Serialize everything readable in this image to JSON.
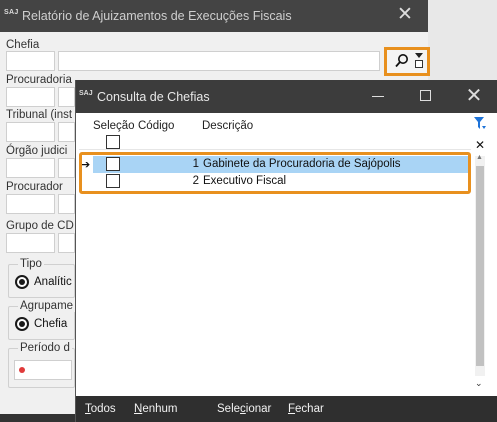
{
  "background_window": {
    "logo": "SAJ",
    "title": "Relatório de Ajuizamentos de Execuções Fiscais",
    "close": "✕",
    "labels": {
      "chefia": "Chefia",
      "procuradoria": "Procuradoria",
      "tribunal": "Tribunal (inst",
      "orgao": "Órgão judici",
      "procurador": "Procurador",
      "grupo": "Grupo de CD"
    },
    "tipo": {
      "legend": "Tipo",
      "option": "Analític"
    },
    "agrupamento": {
      "legend": "Agrupame",
      "option": "Chefia"
    },
    "periodo": {
      "legend": "Período d"
    }
  },
  "dialog": {
    "logo": "SAJ",
    "title": "Consulta de Chefias",
    "columns": {
      "selection": "Seleção",
      "code": "Código",
      "description": "Descrição"
    },
    "rows": [
      {
        "code": "1",
        "description": "Gabinete da Procuradoria de Sajópolis",
        "selected": true,
        "current": true
      },
      {
        "code": "2",
        "description": "Executivo Fiscal",
        "selected": false,
        "current": false
      }
    ],
    "current_row_marker": "➔",
    "clear_filter": "✕",
    "footer": {
      "todos": {
        "key": "T",
        "rest": "odos"
      },
      "nenhum": {
        "key": "N",
        "rest": "enhum"
      },
      "selecionar": {
        "pre": "Sele",
        "key": "c",
        "rest": "ionar"
      },
      "fechar": {
        "key": "F",
        "rest": "echar"
      }
    }
  },
  "colors": {
    "highlight_border": "#e8901e",
    "selected_row": "#a9d4f5",
    "titlebar": "#3c3c3c",
    "footer": "#2f2f2f",
    "filter_icon": "#1e73d8"
  },
  "icons": {
    "search": "search-icon",
    "dropdown": "dropdown-icon",
    "filter": "filter-icon",
    "close": "close-icon"
  }
}
